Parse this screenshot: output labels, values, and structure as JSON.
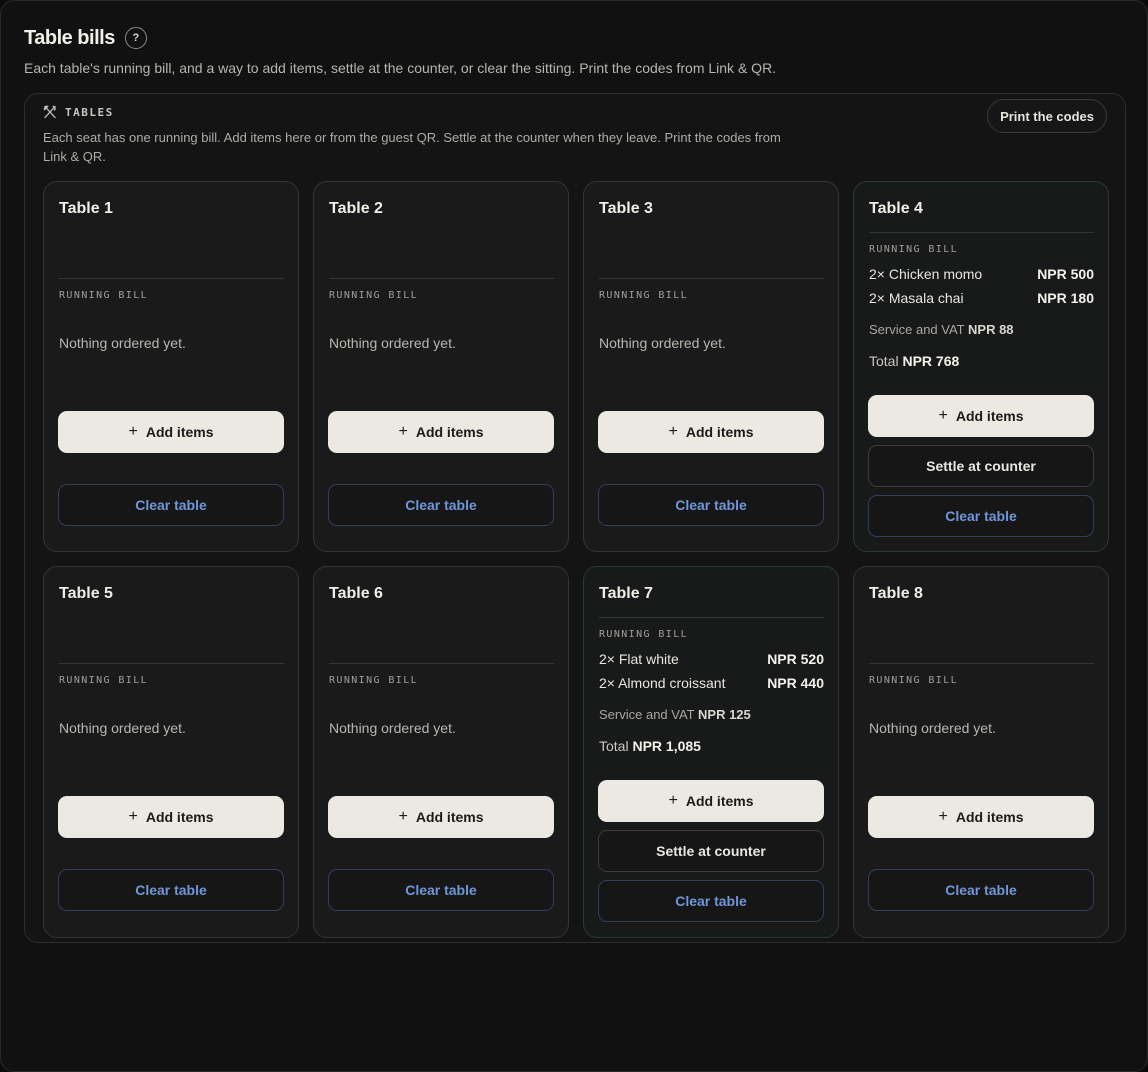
{
  "header": {
    "title": "Table bills",
    "help_glyph": "?",
    "subtitle": "Each table's running bill, and a way to add items, settle at the counter, or clear the sitting. Print the codes from Link & QR."
  },
  "panel": {
    "label": "TABLES",
    "icon": "utensils-icon",
    "description": "Each seat has one running bill. Add items here or from the guest QR. Settle at the counter when they leave. Print the codes from Link & QR.",
    "print_label": "Print the codes"
  },
  "common": {
    "bill_label": "RUNNING BILL",
    "empty_text": "Nothing ordered yet.",
    "add_label": "Add items",
    "settle_label": "Settle at counter",
    "clear_label": "Clear table",
    "service_label": "Service and VAT",
    "total_label": "Total"
  },
  "tables": [
    {
      "name": "Table 1"
    },
    {
      "name": "Table 2"
    },
    {
      "name": "Table 3"
    },
    {
      "name": "Table 4",
      "lines": [
        {
          "item": "2× Chicken momo",
          "amount": "NPR 500"
        },
        {
          "item": "2× Masala chai",
          "amount": "NPR 180"
        }
      ],
      "service": "NPR 88",
      "total": "NPR 768"
    },
    {
      "name": "Table 5"
    },
    {
      "name": "Table 6"
    },
    {
      "name": "Table 7",
      "lines": [
        {
          "item": "2× Flat white",
          "amount": "NPR 520"
        },
        {
          "item": "2× Almond croissant",
          "amount": "NPR 440"
        }
      ],
      "service": "NPR 125",
      "total": "NPR 1,085"
    },
    {
      "name": "Table 8"
    }
  ],
  "colors": {
    "accent_link": "#6f96d8",
    "primary_button": "#ebe9e2",
    "background": "#111111"
  }
}
